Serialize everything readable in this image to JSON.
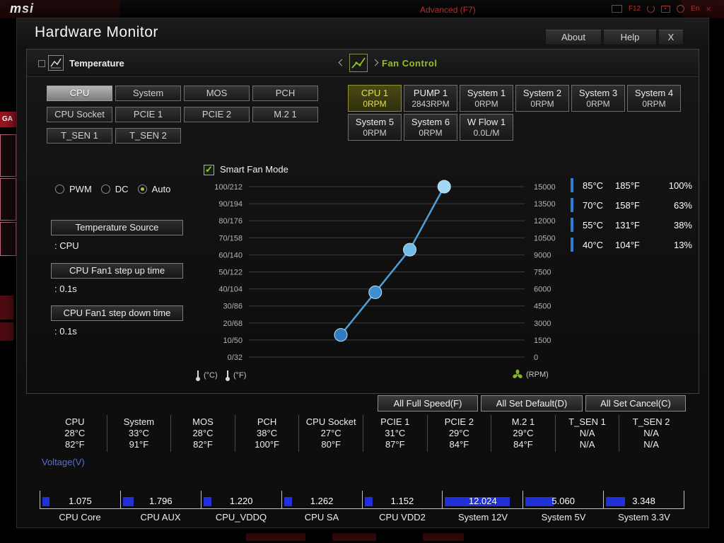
{
  "screen": {
    "brand": "msi",
    "mode_label": "Advanced (F7)",
    "hotkey_label": "F12",
    "lang_label": "En",
    "game_boost_fragment": "GA"
  },
  "window": {
    "title": "Hardware Monitor",
    "about": "About",
    "help": "Help",
    "close": "X"
  },
  "temperature": {
    "title": "Temperature",
    "items": [
      {
        "label": "CPU",
        "selected": true
      },
      {
        "label": "System",
        "selected": false
      },
      {
        "label": "MOS",
        "selected": false
      },
      {
        "label": "PCH",
        "selected": false
      },
      {
        "label": "CPU Socket",
        "selected": false
      },
      {
        "label": "PCIE 1",
        "selected": false
      },
      {
        "label": "PCIE 2",
        "selected": false
      },
      {
        "label": "M.2 1",
        "selected": false
      },
      {
        "label": "T_SEN 1",
        "selected": false
      },
      {
        "label": "T_SEN 2",
        "selected": false
      }
    ]
  },
  "fan_control": {
    "title": "Fan Control",
    "fans": [
      {
        "name": "CPU 1",
        "value": "0RPM",
        "selected": true
      },
      {
        "name": "PUMP 1",
        "value": "2843RPM",
        "selected": false
      },
      {
        "name": "System 1",
        "value": "0RPM",
        "selected": false
      },
      {
        "name": "System 2",
        "value": "0RPM",
        "selected": false
      },
      {
        "name": "System 3",
        "value": "0RPM",
        "selected": false
      },
      {
        "name": "System 4",
        "value": "0RPM",
        "selected": false
      },
      {
        "name": "System 5",
        "value": "0RPM",
        "selected": false
      },
      {
        "name": "System 6",
        "value": "0RPM",
        "selected": false
      },
      {
        "name": "W Flow 1",
        "value": "0.0L/M",
        "selected": false
      }
    ]
  },
  "settings": {
    "modes": [
      {
        "label": "PWM",
        "selected": false
      },
      {
        "label": "DC",
        "selected": false
      },
      {
        "label": "Auto",
        "selected": true
      }
    ],
    "fields": [
      {
        "label": "Temperature Source",
        "value": ": CPU"
      },
      {
        "label": "CPU Fan1 step up time",
        "value": ": 0.1s"
      },
      {
        "label": "CPU Fan1 step down time",
        "value": ": 0.1s"
      }
    ],
    "smart_fan_label": "Smart Fan Mode",
    "smart_fan_checked": true
  },
  "chart_data": {
    "type": "line",
    "title": "Smart Fan Mode",
    "x_axis": {
      "label_c": "(°C)",
      "label_f": "(°F)",
      "range_c": [
        0,
        120
      ]
    },
    "y_left_ticks": [
      "100/212",
      "90/194",
      "80/176",
      "70/158",
      "60/140",
      "50/122",
      "40/104",
      "30/86",
      "20/68",
      "10/50",
      "0/32"
    ],
    "y_right_ticks": [
      "15000",
      "13500",
      "12000",
      "10500",
      "9000",
      "7500",
      "6000",
      "4500",
      "3000",
      "1500",
      "0"
    ],
    "y_right_label": "(RPM)",
    "grid": true,
    "points": [
      {
        "temp_c": 40,
        "duty_pct": 13
      },
      {
        "temp_c": 55,
        "duty_pct": 38
      },
      {
        "temp_c": 70,
        "duty_pct": 63
      },
      {
        "temp_c": 85,
        "duty_pct": 100
      }
    ],
    "legend": [
      {
        "c": "85°C",
        "f": "185°F",
        "pct": "100%"
      },
      {
        "c": "70°C",
        "f": "158°F",
        "pct": "63%"
      },
      {
        "c": "55°C",
        "f": "131°F",
        "pct": "38%"
      },
      {
        "c": "40°C",
        "f": "104°F",
        "pct": "13%"
      }
    ],
    "legend_position": "right"
  },
  "actions": [
    {
      "label": "All Full Speed(F)"
    },
    {
      "label": "All Set Default(D)"
    },
    {
      "label": "All Set Cancel(C)"
    }
  ],
  "sensors": [
    {
      "name": "CPU",
      "c": "28°C",
      "f": "82°F"
    },
    {
      "name": "System",
      "c": "33°C",
      "f": "91°F"
    },
    {
      "name": "MOS",
      "c": "28°C",
      "f": "82°F"
    },
    {
      "name": "PCH",
      "c": "38°C",
      "f": "100°F"
    },
    {
      "name": "CPU Socket",
      "c": "27°C",
      "f": "80°F"
    },
    {
      "name": "PCIE 1",
      "c": "31°C",
      "f": "87°F"
    },
    {
      "name": "PCIE 2",
      "c": "29°C",
      "f": "84°F"
    },
    {
      "name": "M.2 1",
      "c": "29°C",
      "f": "84°F"
    },
    {
      "name": "T_SEN 1",
      "c": "N/A",
      "f": "N/A"
    },
    {
      "name": "T_SEN 2",
      "c": "N/A",
      "f": "N/A"
    }
  ],
  "voltage": {
    "title": "Voltage(V)",
    "items": [
      {
        "name": "CPU Core",
        "value": "1.075",
        "volts": 1.075
      },
      {
        "name": "CPU AUX",
        "value": "1.796",
        "volts": 1.796
      },
      {
        "name": "CPU_VDDQ",
        "value": "1.220",
        "volts": 1.22
      },
      {
        "name": "CPU SA",
        "value": "1.262",
        "volts": 1.262
      },
      {
        "name": "CPU VDD2",
        "value": "1.152",
        "volts": 1.152
      },
      {
        "name": "System 12V",
        "value": "12.024",
        "volts": 12.024
      },
      {
        "name": "System 5V",
        "value": "5.060",
        "volts": 5.06
      },
      {
        "name": "System 3.3V",
        "value": "3.348",
        "volts": 3.348
      }
    ]
  },
  "colors": {
    "accent_green": "#95c11f",
    "curve_blue": "#4f9fd8",
    "legend_blue": "#2d7dd2",
    "voltage_blue": "#2230d8",
    "alert_red": "#c0392b"
  }
}
